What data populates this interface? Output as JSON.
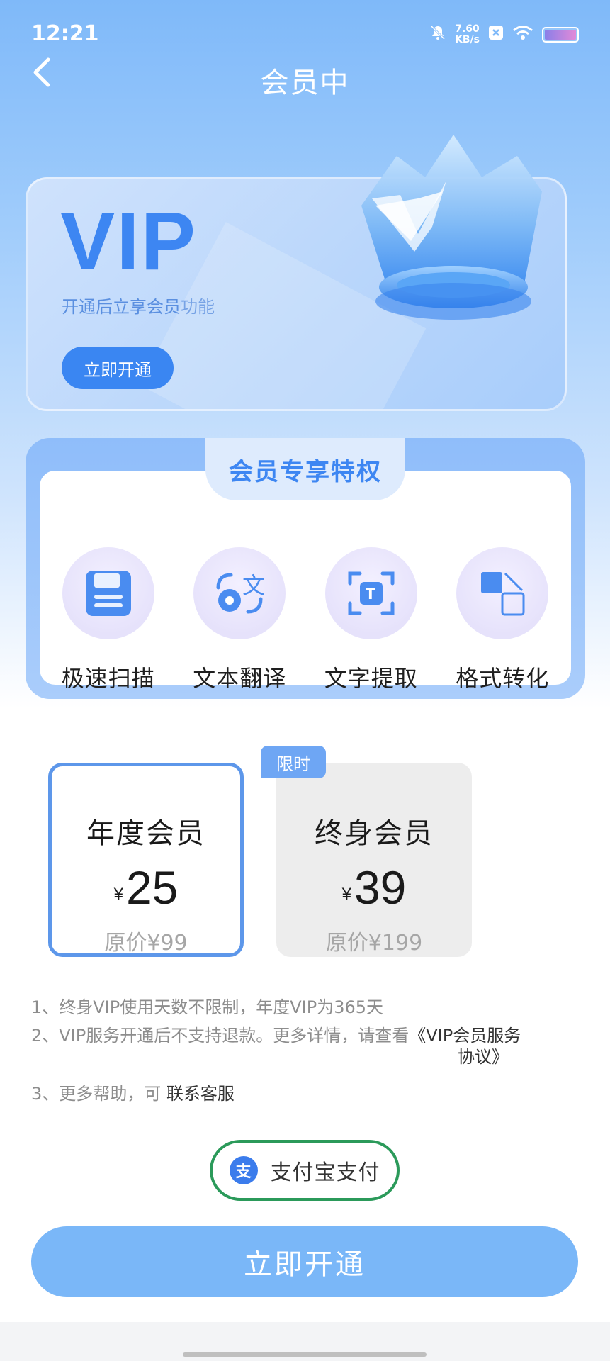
{
  "status_bar": {
    "time": "12:21",
    "net_speed_value": "7.60",
    "net_speed_unit": "KB/s",
    "icons": [
      "mute-bell-icon",
      "close-box-icon",
      "wifi-icon",
      "battery-icon"
    ]
  },
  "header": {
    "back_icon": "chevron-left-icon",
    "title": "会员中"
  },
  "vip_card": {
    "title": "VIP",
    "subtitle": "开通后立享会员功能",
    "button_label": "立即开通",
    "illustration": "crown-icon"
  },
  "privileges": {
    "title": "会员专享特权",
    "items": [
      {
        "label": "极速扫描",
        "icon": "floppy-disk-icon"
      },
      {
        "label": "文本翻译",
        "icon": "translate-icon"
      },
      {
        "label": "文字提取",
        "icon": "text-extract-icon"
      },
      {
        "label": "格式转化",
        "icon": "format-convert-icon"
      }
    ]
  },
  "plans": {
    "limited_badge": "限时",
    "currency_symbol": "¥",
    "items": [
      {
        "name": "年度会员",
        "price": "25",
        "original_price": "原价¥99",
        "selected": true
      },
      {
        "name": "终身会员",
        "price": "39",
        "original_price": "原价¥199",
        "selected": false
      }
    ]
  },
  "notes": {
    "line1": "1、终身VIP使用天数不限制，年度VIP为365天",
    "line2_prefix": "2、VIP服务开通后不支持退款。更多详情，请查看",
    "line2_link_head": "《VIP会员服务",
    "line2_link_tail": "协议》",
    "line3_prefix": "3、更多帮助，可",
    "line3_link": "联系客服"
  },
  "payment": {
    "icon": "alipay-icon",
    "icon_glyph": "支",
    "label": "支付宝支付"
  },
  "cta": {
    "label": "立即开通"
  },
  "colors": {
    "primary": "#3d86f2",
    "cta": "#7ab7f8",
    "pay_border": "#2b9a5a",
    "selected_border": "#5d97ea"
  }
}
